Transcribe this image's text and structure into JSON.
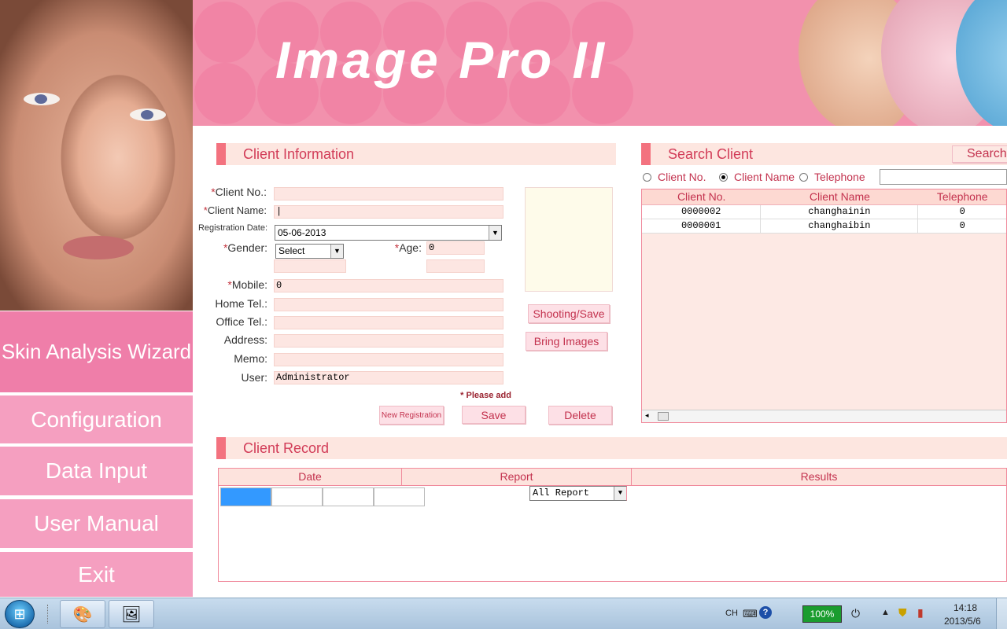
{
  "header": {
    "title": "Image Pro II"
  },
  "nav": {
    "skin_analysis_wizard": "Skin Analysis Wizard",
    "configuration": "Configuration",
    "data_input": "Data Input",
    "user_manual": "User Manual",
    "exit": "Exit"
  },
  "client_info": {
    "section_title": "Client Information",
    "labels": {
      "client_no": "Client No.:",
      "client_name": "Client Name:",
      "registration_date": "Registration Date:",
      "gender": "Gender:",
      "age": "Age:",
      "mobile": "Mobile:",
      "home_tel": "Home Tel.:",
      "office_tel": "Office Tel.:",
      "address": "Address:",
      "memo": "Memo:",
      "user": "User:"
    },
    "required_mark": "*",
    "values": {
      "client_no": "",
      "client_name": "|",
      "registration_date": "05-06-2013",
      "gender": "Select",
      "age": "0",
      "mobile": "0",
      "home_tel": "",
      "office_tel": "",
      "address": "",
      "memo": "",
      "user": "Administrator"
    },
    "buttons": {
      "shooting_save": "Shooting/Save",
      "bring_images": "Bring Images",
      "new_registration": "New Registration",
      "save": "Save",
      "delete": "Delete"
    },
    "please_add": "* Please add"
  },
  "search_client": {
    "section_title": "Search Client",
    "search_button": "Search",
    "radio_options": [
      "Client No.",
      "Client Name",
      "Telephone"
    ],
    "selected_radio": "Client Name",
    "search_value": "",
    "columns": [
      "Client No.",
      "Client Name",
      "Telephone"
    ],
    "rows": [
      [
        "0000002",
        "changhainin",
        "0"
      ],
      [
        "0000001",
        "changhaibin",
        "0"
      ]
    ]
  },
  "client_record": {
    "section_title": "Client Record",
    "columns": {
      "date": "Date",
      "report": "Report",
      "results": "Results"
    },
    "report_filter": "All Report"
  },
  "taskbar": {
    "lang": "CH",
    "battery": "100%",
    "time": "14:18",
    "date": "2013/5/6"
  },
  "colors": {
    "pink_header": "#f291ad",
    "nav_pink": "#f59fc0",
    "accent_red": "#c3324e",
    "section_bar": "#f3727f"
  }
}
